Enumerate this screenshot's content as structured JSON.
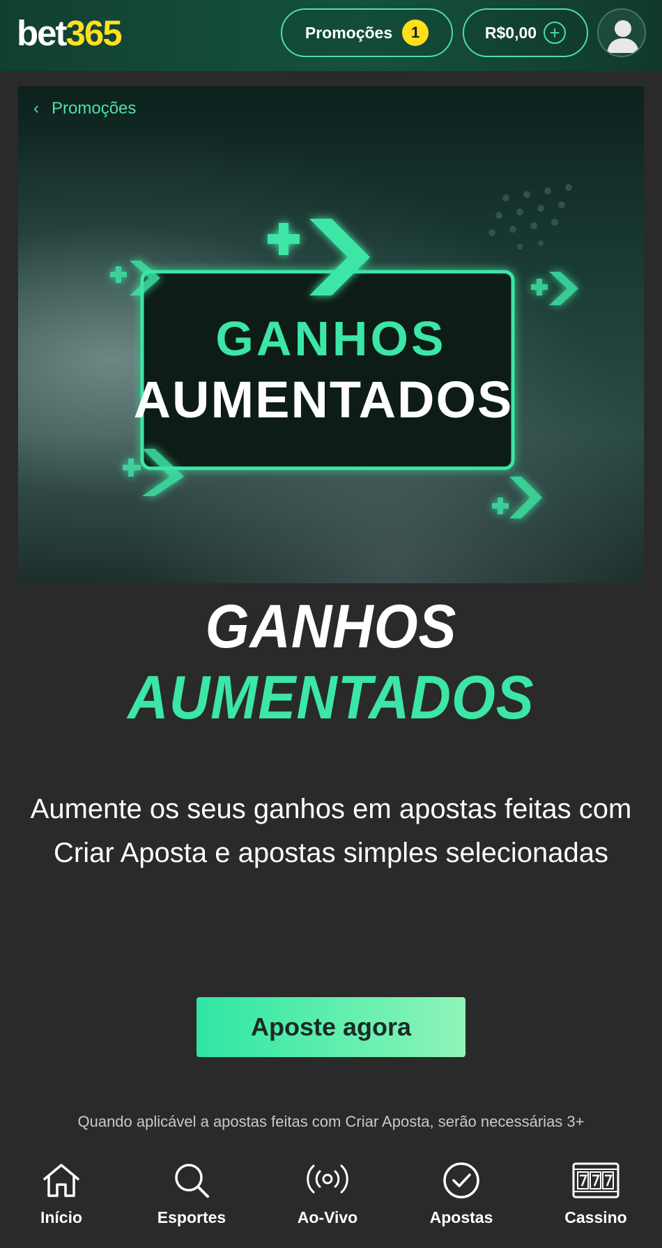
{
  "header": {
    "logo_part1": "bet",
    "logo_part2": "365",
    "promotions_label": "Promoções",
    "promotions_count": "1",
    "balance": "R$0,00",
    "add_funds_symbol": "+"
  },
  "hero": {
    "breadcrumb_label": "Promoções",
    "banner_line1": "GANHOS",
    "banner_line2": "AUMENTADOS"
  },
  "main": {
    "title_line1": "GANHOS",
    "title_line2": "AUMENTADOS",
    "description": "Aumente os seus ganhos em apostas feitas com Criar Aposta e apostas simples selecionadas",
    "cta_label": "Aposte agora",
    "fineprint": "Quando aplicável a apostas feitas com Criar Aposta, serão necessárias 3+"
  },
  "bottom_nav": {
    "items": [
      {
        "label": "Início",
        "icon": "home-icon"
      },
      {
        "label": "Esportes",
        "icon": "search-icon"
      },
      {
        "label": "Ao-Vivo",
        "icon": "live-icon"
      },
      {
        "label": "Apostas",
        "icon": "check-circle-icon"
      },
      {
        "label": "Cassino",
        "icon": "slot-machine-icon"
      }
    ]
  },
  "colors": {
    "accent_green": "#3ce6a6",
    "header_bg": "#15513e",
    "badge_yellow": "#ffdf1b",
    "page_bg": "#2a2a2a"
  }
}
